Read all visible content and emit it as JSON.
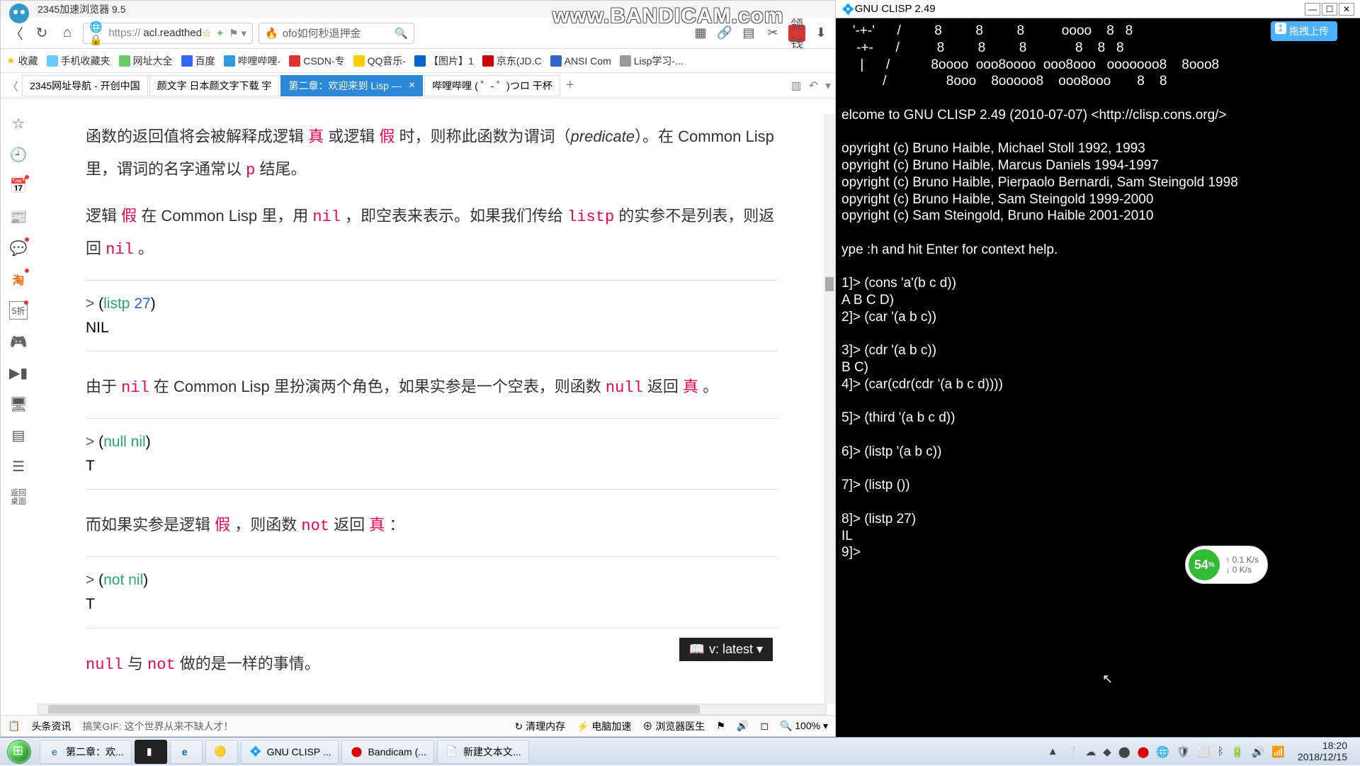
{
  "browser": {
    "title": "2345加速浏览器 9.5",
    "url_display": "acl.readthed",
    "url_prefix": "https://",
    "search_placeholder": "ofo如何秒退押金",
    "red_button": "领钱",
    "bookmarks_label": "收藏",
    "bookmarks": [
      "手机收藏夹",
      "网址大全",
      "百度",
      "哔哩哔哩-",
      "CSDN-专",
      "QQ音乐-",
      "【图片】1",
      "京东(JD.C",
      "ANSI Com",
      "Lisp学习-..."
    ],
    "tabs": [
      {
        "label": "2345网址导航 - 开创中国"
      },
      {
        "label": "颜文字 日本颜文字下载 宇"
      },
      {
        "label": "第二章：欢迎来到 Lisp —",
        "active": true
      },
      {
        "label": "哔哩哔哩 ( ゜- ゜)つロ 干杯"
      }
    ],
    "content": {
      "p1_a": "函数的返回值将会被解释成逻辑 ",
      "p1_true": "真",
      "p1_b": " 或逻辑 ",
      "p1_false": "假",
      "p1_c": " 时，则称此函数为谓词（",
      "p1_pred": "predicate",
      "p1_d": "）。在 Common Lisp 里，谓词的名字通常以 ",
      "p1_p": "p",
      "p1_e": " 结尾。",
      "p2_a": "逻辑 ",
      "p2_false": "假",
      "p2_b": " 在 Common Lisp 里，用 ",
      "p2_nil": "nil",
      "p2_c": " ，即空表来表示。如果我们传给 ",
      "p2_listp": "listp",
      "p2_d": " 的实参不是列表，则返回 ",
      "p2_nil2": "nil",
      "p2_e": " 。",
      "code1_line1": "> (listp 27)",
      "code1_line2": "NIL",
      "p3_a": "由于 ",
      "p3_nil": "nil",
      "p3_b": " 在 Common Lisp 里扮演两个角色，如果实参是一个空表，则函数 ",
      "p3_null": "null",
      "p3_c": " 返回 ",
      "p3_true": "真",
      "p3_d": " 。",
      "code2_line1": "> (null nil)",
      "code2_line2": "T",
      "p4_a": "而如果实参是逻辑 ",
      "p4_false": "假",
      "p4_b": " ，则函数 ",
      "p4_not": "not",
      "p4_c": " 返回 ",
      "p4_true": "真",
      "p4_d": " ：",
      "code3_line1": "> (not nil)",
      "code3_line2": "T",
      "p5_a": "",
      "p5_null": "null",
      "p5_b": " 与 ",
      "p5_not": "not",
      "p5_c": " 做的是一样的事情。"
    },
    "version_badge": "v: latest ▾",
    "status": {
      "left1": "头条资讯",
      "left2": "搞笑GIF: 这个世界从来不缺人才！",
      "r1": "清理内存",
      "r2": "电脑加速",
      "r3": "浏览器医生",
      "zoom": "100%"
    }
  },
  "terminal": {
    "title": "GNU CLISP 2.49",
    "body": "   '-+-'      /         8         8         8          oooo    8   8\n    -+-      /          8         8         8             8    8   8\n     |      /           8oooo  ooo8oooo  ooo8ooo   ooooooo8    8ooo8\n           /                8ooo    8ooooo8    ooo8ooo       8    8\n\nelcome to GNU CLISP 2.49 (2010-07-07) <http://clisp.cons.org/>\n\nopyright (c) Bruno Haible, Michael Stoll 1992, 1993\nopyright (c) Bruno Haible, Marcus Daniels 1994-1997\nopyright (c) Bruno Haible, Pierpaolo Bernardi, Sam Steingold 1998\nopyright (c) Bruno Haible, Sam Steingold 1999-2000\nopyright (c) Sam Steingold, Bruno Haible 2001-2010\n\nype :h and hit Enter for context help.\n\n1]> (cons 'a'(b c d))\nA B C D)\n2]> (car '(a b c))\n\n3]> (cdr '(a b c))\nB C)\n4]> (car(cdr(cdr '(a b c d))))\n\n5]> (third '(a b c d))\n\n6]> (listp '(a b c))\n\n7]> (listp ())\n\n8]> (listp 27)\nIL\n9]> "
  },
  "bandicam": "www.BANDICAM.com",
  "upload_pill": "拖拽上传",
  "netwidget": {
    "pct": "54",
    "up": "↑ 0.1 K/s",
    "down": "↓ 0 K/s"
  },
  "taskbar": {
    "items": [
      {
        "label": "第二章：欢..."
      },
      {
        "label": ""
      },
      {
        "label": ""
      },
      {
        "label": ""
      },
      {
        "label": "GNU CLISP ..."
      },
      {
        "label": "Bandicam (..."
      },
      {
        "label": "新建文本文..."
      }
    ],
    "time": "18:20",
    "date": "2018/12/15"
  }
}
